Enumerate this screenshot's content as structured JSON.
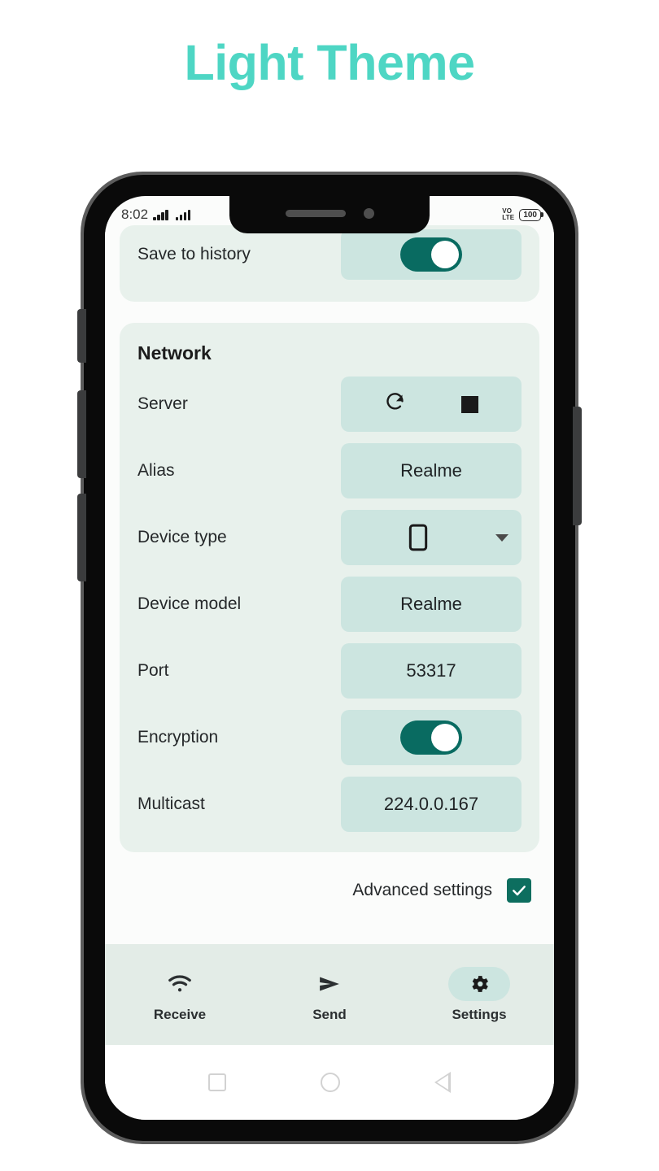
{
  "page": {
    "title": "Light Theme",
    "accent_color": "#4ed6c4",
    "background": "#ffffff"
  },
  "status_bar": {
    "time": "8:02",
    "signal_icon": "signal-bars-icon",
    "network_line1": "VO",
    "network_line2": "LTE",
    "battery_level": "100"
  },
  "settings": {
    "save_to_history": {
      "label": "Save to history",
      "toggle_state": "on"
    },
    "network_card": {
      "title": "Network",
      "rows": [
        {
          "label": "Server",
          "type": "icons",
          "value": "",
          "icons": [
            "restart-icon",
            "stop-icon"
          ]
        },
        {
          "label": "Alias",
          "type": "text",
          "value": "Realme"
        },
        {
          "label": "Device type",
          "type": "select",
          "value": "",
          "icon": "smartphone-icon"
        },
        {
          "label": "Device model",
          "type": "text",
          "value": "Realme"
        },
        {
          "label": "Port",
          "type": "text",
          "value": "53317"
        },
        {
          "label": "Encryption",
          "type": "toggle",
          "value": "",
          "toggle_state": "on"
        },
        {
          "label": "Multicast",
          "type": "text",
          "value": "224.0.0.167"
        }
      ]
    },
    "advanced": {
      "label": "Advanced settings",
      "checked": true
    }
  },
  "bottom_nav": {
    "items": [
      {
        "label": "Receive",
        "icon": "wifi-icon",
        "active": false
      },
      {
        "label": "Send",
        "icon": "send-icon",
        "active": false
      },
      {
        "label": "Settings",
        "icon": "gear-icon",
        "active": true
      }
    ]
  },
  "android_nav": {
    "recents": "square-icon",
    "home": "circle-icon",
    "back": "triangle-back-icon"
  },
  "colors": {
    "accent": "#4ed6c4",
    "card_bg": "#e8f1ec",
    "value_bg": "#cce5e0",
    "toggle_on": "#096b61",
    "checkbox": "#0d6e5f",
    "nav_bg": "#e3ece7"
  }
}
